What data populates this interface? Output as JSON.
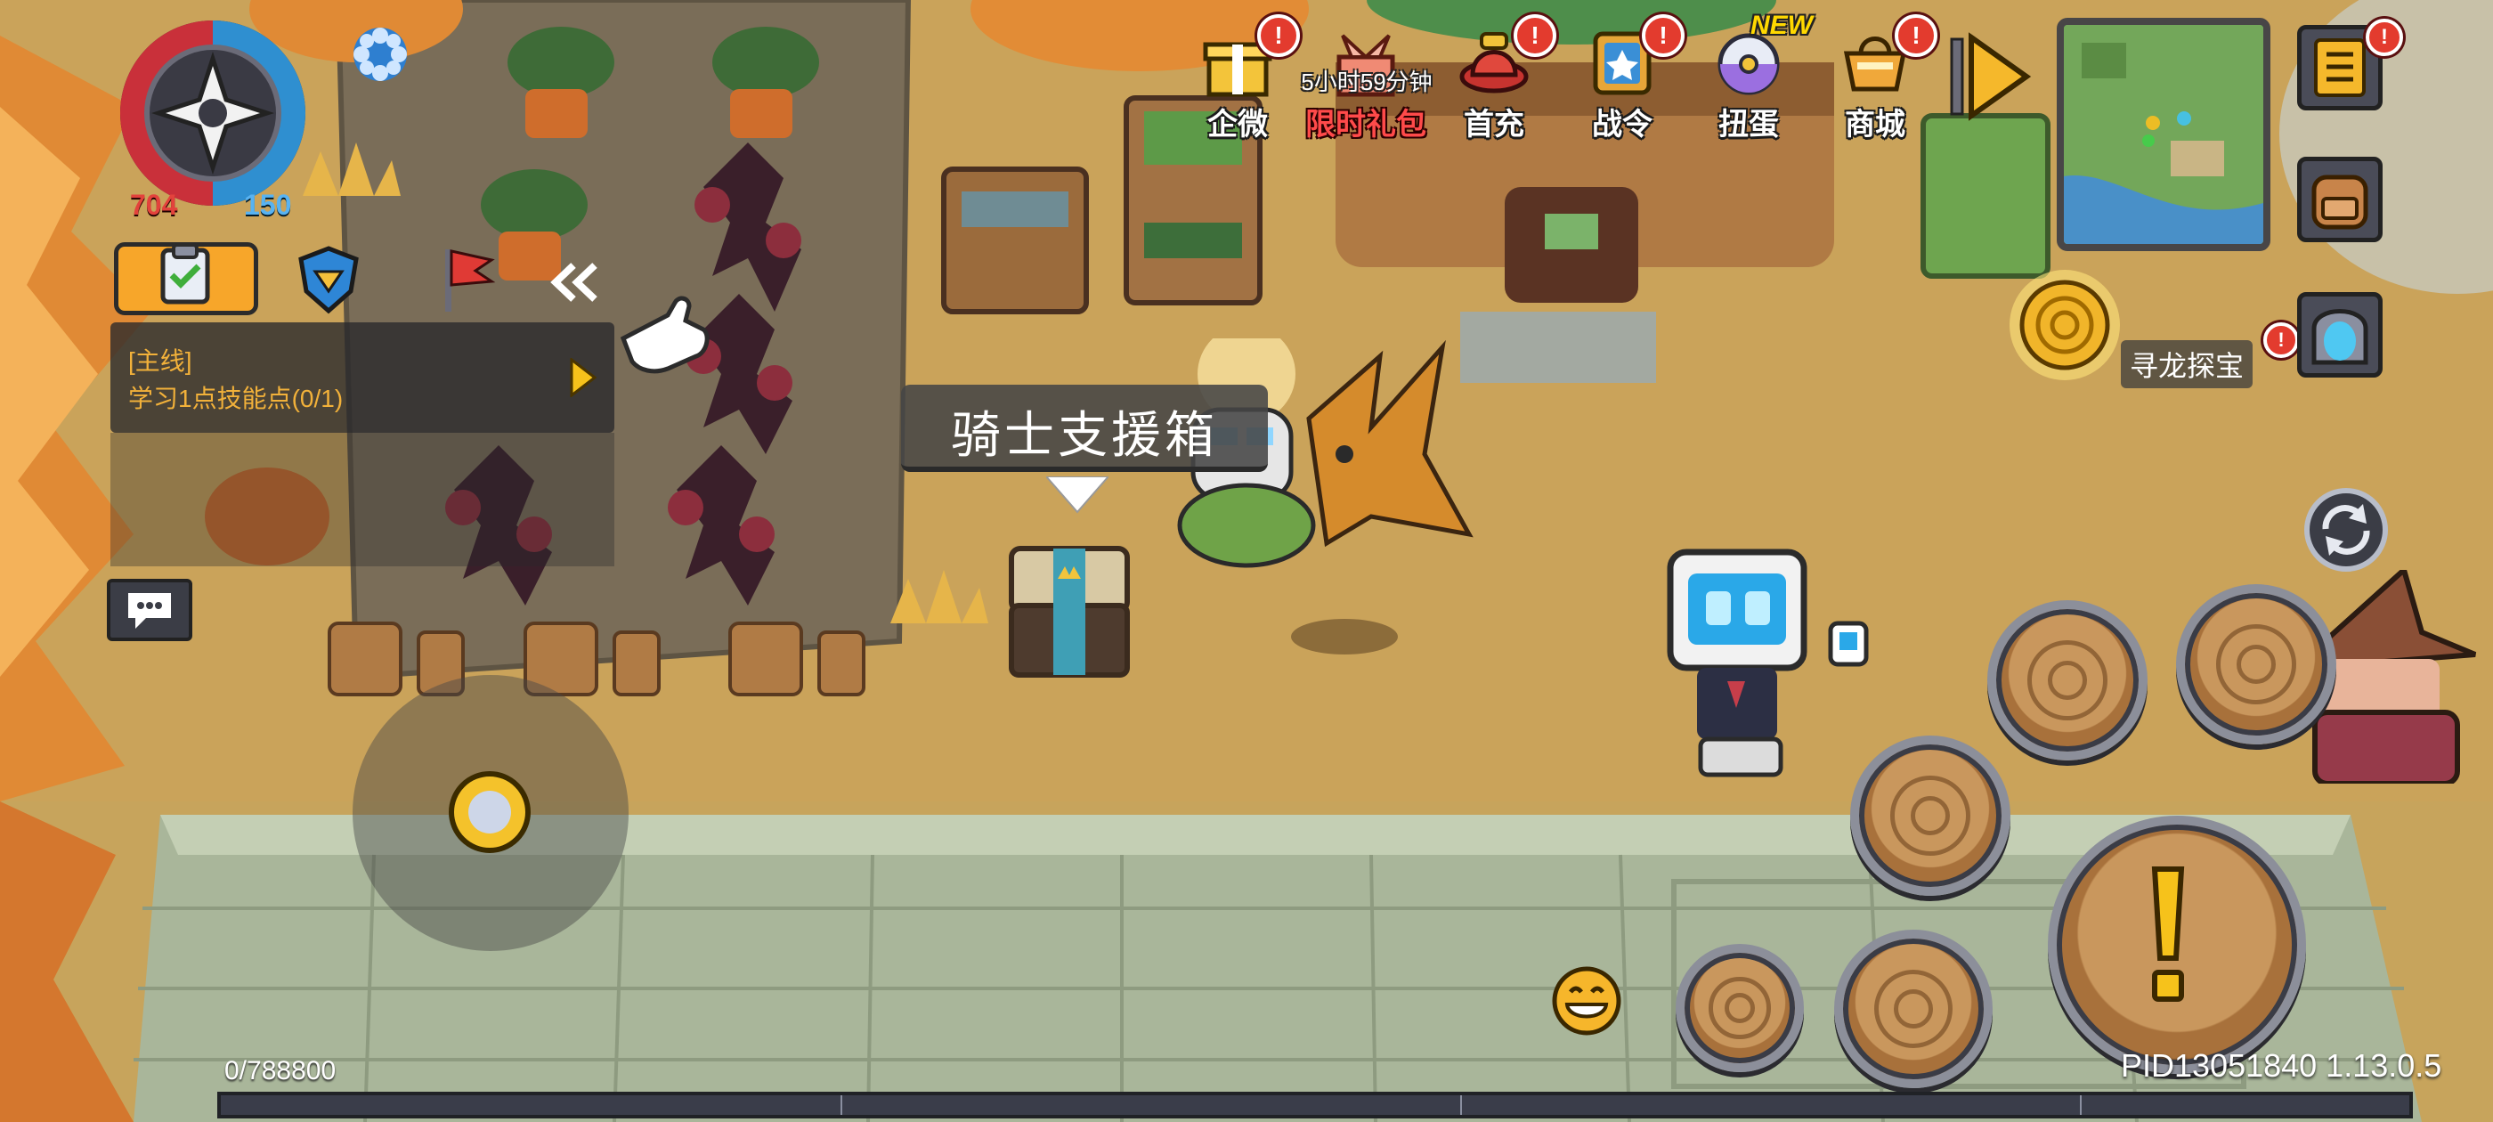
{
  "hud": {
    "hp": "704",
    "energy": "150",
    "exp": "0/788800",
    "pid_version": "PID13051840 1.13.0.5"
  },
  "top_menu": [
    {
      "label": "企微",
      "icon": "gift-box-icon",
      "badge": "!"
    },
    {
      "label": "限时礼包",
      "icon": "ribbon-gift-icon",
      "timer": "5小时59分钟"
    },
    {
      "label": "首充",
      "icon": "first-charge-hat-icon",
      "badge": "!"
    },
    {
      "label": "战令",
      "icon": "battle-pass-book-icon",
      "badge": "!"
    },
    {
      "label": "扭蛋",
      "icon": "gacha-capsule-icon",
      "tag": "NEW"
    },
    {
      "label": "商城",
      "icon": "shop-basket-icon",
      "badge": "!"
    }
  ],
  "quest": {
    "category": "[主线]",
    "description": "学习1点技能点(0/1)"
  },
  "dragon_hunt": {
    "label": "寻龙探宝",
    "badge": "!"
  },
  "npc_prompt": {
    "label": "骑士支援箱"
  },
  "colors": {
    "accent_orange": "#f5a623",
    "badge_red": "#e33b2e",
    "limited_gift_red": "#ff4a4a",
    "stone_floor": "#a9b69a"
  }
}
